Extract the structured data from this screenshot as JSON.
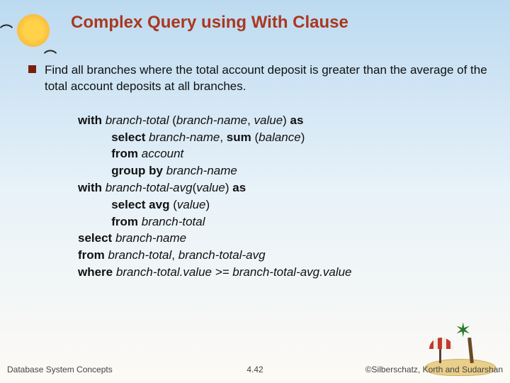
{
  "title": "Complex Query using With Clause",
  "bullet": "Find all branches where the total account deposit is greater than the average of the total account deposits at all branches.",
  "code": {
    "l1a": "with ",
    "l1b": "branch-total ",
    "l1c": "(",
    "l1d": "branch-name",
    "l1e": ", ",
    "l1f": "value",
    "l1g": ") ",
    "l1h": "as",
    "l2a": "          select ",
    "l2b": "branch-name",
    "l2c": ", ",
    "l2d": "sum ",
    "l2e": "(",
    "l2f": "balance",
    "l2g": ")",
    "l3a": "          from ",
    "l3b": "account",
    "l4a": "          group by ",
    "l4b": "branch-name",
    "l5a": "with ",
    "l5b": "branch-total-avg",
    "l5c": "(",
    "l5d": "value",
    "l5e": ") ",
    "l5f": "as",
    "l6a": "          select avg ",
    "l6b": "(",
    "l6c": "value",
    "l6d": ")",
    "l7a": "          from ",
    "l7b": "branch-total",
    "l8a": "select ",
    "l8b": "branch-name",
    "l9a": "from ",
    "l9b": "branch-total",
    "l9c": ", ",
    "l9d": "branch-total-avg",
    "l10a": "where ",
    "l10b": "branch-total.value >= branch-total-avg.value"
  },
  "footer": {
    "left": "Database System Concepts",
    "center": "4.42",
    "right": "©Silberschatz, Korth and Sudarshan"
  }
}
